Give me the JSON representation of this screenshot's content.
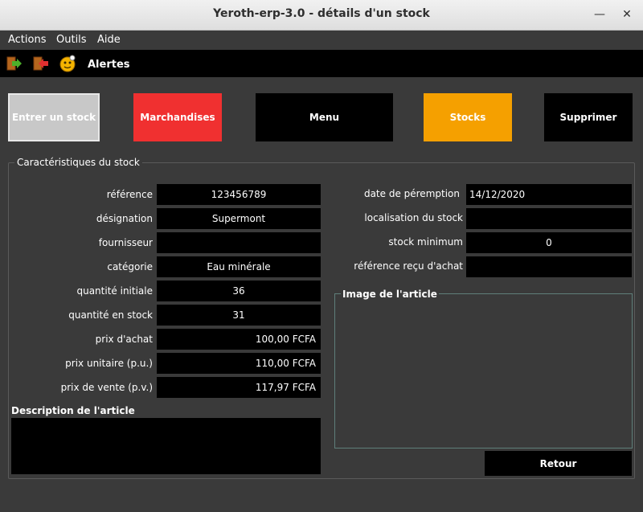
{
  "window": {
    "title": "Yeroth-erp-3.0 - détails d'un stock"
  },
  "menubar": {
    "items": [
      "Actions",
      "Outils",
      "Aide"
    ]
  },
  "toolbar": {
    "alertes_label": "Alertes"
  },
  "buttons": {
    "entrer_stock": "Entrer un stock",
    "marchandises": "Marchandises",
    "menu": "Menu",
    "stocks": "Stocks",
    "supprimer": "Supprimer",
    "retour": "Retour"
  },
  "colors": {
    "entrer_stock_bg": "#c8c8c8",
    "marchandises_bg": "#f03030",
    "stocks_bg": "#f5a000",
    "dark_bg": "#000000"
  },
  "group": {
    "title": "Caractéristiques du stock"
  },
  "left_fields": [
    {
      "label": "référence",
      "value": "123456789"
    },
    {
      "label": "désignation",
      "value": "Supermont"
    },
    {
      "label": "fournisseur",
      "value": ""
    },
    {
      "label": "catégorie",
      "value": "Eau minérale"
    },
    {
      "label": "quantité initiale",
      "value": "36"
    },
    {
      "label": "quantité en stock",
      "value": "31"
    },
    {
      "label": "prix d'achat",
      "value": "100,00 FCFA"
    },
    {
      "label": "prix unitaire (p.u.)",
      "value": "110,00 FCFA"
    },
    {
      "label": "prix de vente (p.v.)",
      "value": "117,97 FCFA"
    }
  ],
  "right_fields": [
    {
      "label": "date de péremption",
      "value": "14/12/2020"
    },
    {
      "label": "localisation du stock",
      "value": ""
    },
    {
      "label": "stock minimum",
      "value": "0"
    },
    {
      "label": "référence reçu d'achat",
      "value": ""
    }
  ],
  "description": {
    "title": "Description de l'article",
    "value": ""
  },
  "image": {
    "title": "Image de l'article"
  }
}
